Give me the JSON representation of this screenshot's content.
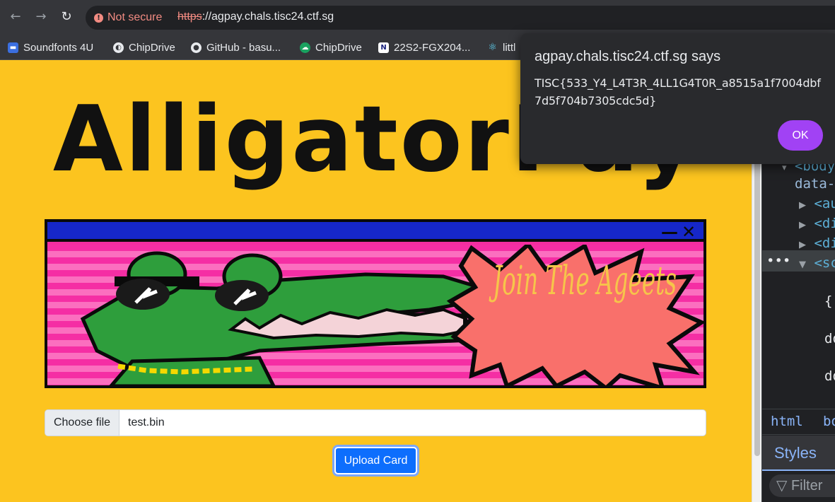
{
  "browser": {
    "back_icon": "arrow-left-icon",
    "forward_icon": "arrow-right-icon",
    "reload_icon": "reload-icon",
    "security_label": "Not secure",
    "url_scheme": "https",
    "url_rest": "://agpay.chals.tisc24.ctf.sg",
    "bookmarks": [
      {
        "label": "Soundfonts 4U",
        "color": "#3b6fe0"
      },
      {
        "label": "ChipDrive",
        "color": "#e8eaed"
      },
      {
        "label": "GitHub - basu...",
        "color": "#e8eaed"
      },
      {
        "label": "ChipDrive",
        "color": "#1aa260"
      },
      {
        "label": "22S2-FGX204...",
        "color": "#ffffff"
      },
      {
        "label": "littl",
        "color": "#61dafb"
      }
    ]
  },
  "page": {
    "brand": "AlligatorPay",
    "banner_text": "Join The Ageets",
    "file_button": "Choose file",
    "file_name": "test.bin",
    "upload_label": "Upload Card"
  },
  "dialog": {
    "title": "agpay.chals.tisc24.ctf.sg says",
    "message": "TISC{533_Y4_L4T3R_4LL1G4T0R_a8515a1f7004dbf7d5f704b7305cdc5d}",
    "ok_label": "OK"
  },
  "devtools": {
    "lines": [
      "<body",
      "data-",
      "<au",
      "<di",
      "<di",
      "<sc",
      "{",
      "do",
      "do"
    ],
    "crumbs": [
      "html",
      "bo"
    ],
    "tab_styles": "Styles",
    "filter": "Filter"
  },
  "colors": {
    "page_bg": "#fcc41f",
    "banner_pink": "#f32ea0",
    "titlebar_blue": "#1627c9",
    "ok_purple": "#a142f4",
    "upload_blue": "#0d6efd"
  }
}
